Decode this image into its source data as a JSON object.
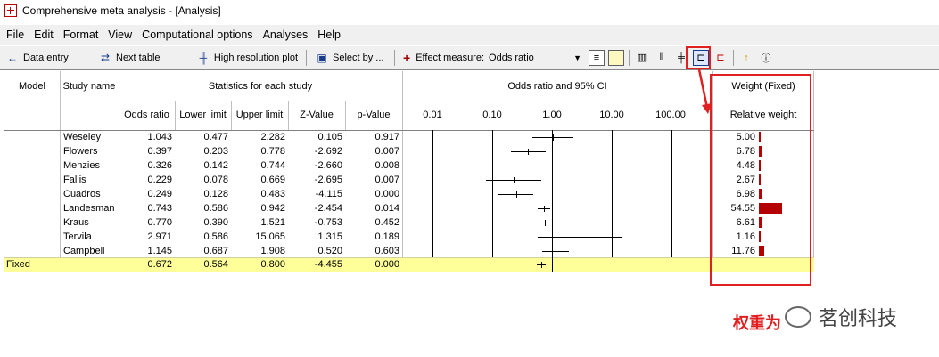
{
  "window": {
    "title": "Comprehensive meta analysis - [Analysis]"
  },
  "menu": [
    "File",
    "Edit",
    "Format",
    "View",
    "Computational options",
    "Analyses",
    "Help"
  ],
  "toolbar": {
    "data_entry": "Data entry",
    "next_table": "Next table",
    "high_res_plot": "High resolution plot",
    "select_by": "Select by ...",
    "effect_measure_label": "Effect measure:",
    "effect_measure_value": "Odds ratio"
  },
  "table": {
    "col_model": "Model",
    "col_study": "Study name",
    "group_stats": "Statistics for each study",
    "group_plot": "Odds ratio and 95% CI",
    "group_weight": "Weight (Fixed)",
    "sub_odds": "Odds ratio",
    "sub_lower": "Lower limit",
    "sub_upper": "Upper limit",
    "sub_z": "Z-Value",
    "sub_p": "p-Value",
    "sub_weight": "Relative weight",
    "axis_ticks": [
      "0.01",
      "0.10",
      "1.00",
      "10.00",
      "100.00"
    ],
    "rows": [
      {
        "study": "Weseley",
        "or": "1.043",
        "lower": "0.477",
        "upper": "2.282",
        "z": "0.105",
        "p": "0.917",
        "w": "5.00"
      },
      {
        "study": "Flowers",
        "or": "0.397",
        "lower": "0.203",
        "upper": "0.778",
        "z": "-2.692",
        "p": "0.007",
        "w": "6.78"
      },
      {
        "study": "Menzies",
        "or": "0.326",
        "lower": "0.142",
        "upper": "0.744",
        "z": "-2.660",
        "p": "0.008",
        "w": "4.48"
      },
      {
        "study": "Fallis",
        "or": "0.229",
        "lower": "0.078",
        "upper": "0.669",
        "z": "-2.695",
        "p": "0.007",
        "w": "2.67"
      },
      {
        "study": "Cuadros",
        "or": "0.249",
        "lower": "0.128",
        "upper": "0.483",
        "z": "-4.115",
        "p": "0.000",
        "w": "6.98"
      },
      {
        "study": "Landesman",
        "or": "0.743",
        "lower": "0.586",
        "upper": "0.942",
        "z": "-2.454",
        "p": "0.014",
        "w": "54.55"
      },
      {
        "study": "Kraus",
        "or": "0.770",
        "lower": "0.390",
        "upper": "1.521",
        "z": "-0.753",
        "p": "0.452",
        "w": "6.61"
      },
      {
        "study": "Tervila",
        "or": "2.971",
        "lower": "0.586",
        "upper": "15.065",
        "z": "1.315",
        "p": "0.189",
        "w": "1.16"
      },
      {
        "study": "Campbell",
        "or": "1.145",
        "lower": "0.687",
        "upper": "1.908",
        "z": "0.520",
        "p": "0.603",
        "w": "11.76"
      }
    ],
    "fixed": {
      "model": "Fixed",
      "or": "0.672",
      "lower": "0.564",
      "upper": "0.800",
      "z": "-4.455",
      "p": "0.000"
    }
  },
  "annotation": "权重为",
  "watermark": "茗创科技",
  "colors": {
    "highlight_row": "#ffff99",
    "weight_bar": "#b40000",
    "annotation": "#e02020"
  }
}
